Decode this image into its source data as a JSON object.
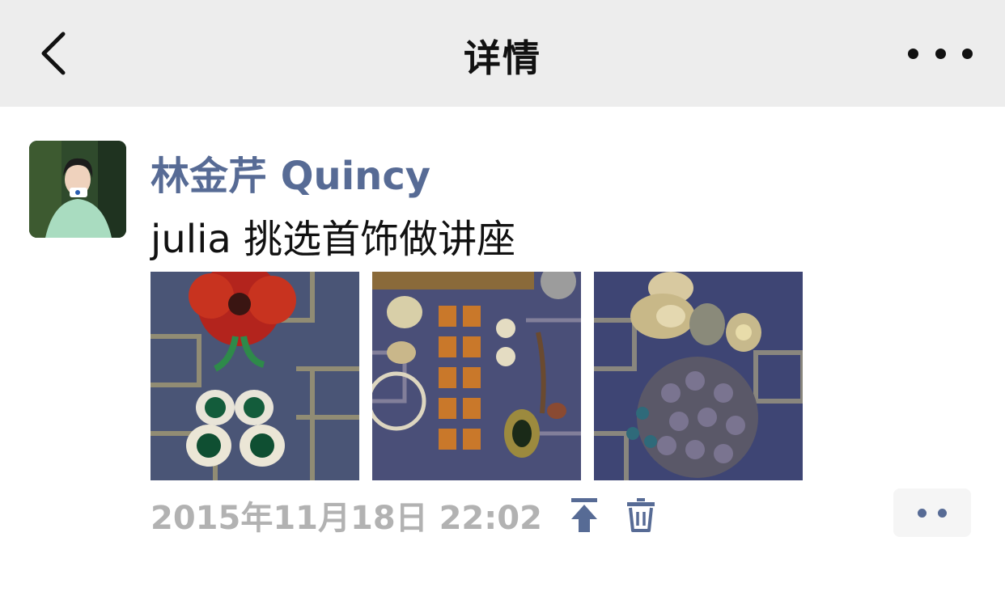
{
  "navbar": {
    "title": "详情",
    "back_icon": "chevron-left-icon",
    "more_icon": "ellipsis-icon"
  },
  "post": {
    "author": "林金芹 Quincy",
    "text": "julia 挑选首饰做讲座",
    "photos": [
      {
        "subject": "red flower brooch and green stone earrings"
      },
      {
        "subject": "amber bracelet and brooches"
      },
      {
        "subject": "golden brooches and beaded cluster"
      }
    ],
    "timestamp": "2015年11月18日 22:02",
    "actions": {
      "pin_icon": "pin-top-icon",
      "delete_icon": "trash-icon",
      "comment_icon": "two-dots-icon"
    }
  },
  "colors": {
    "link_blue": "#576b95",
    "navbar_bg": "#ededed",
    "timestamp_gray": "#b2b2b2"
  }
}
